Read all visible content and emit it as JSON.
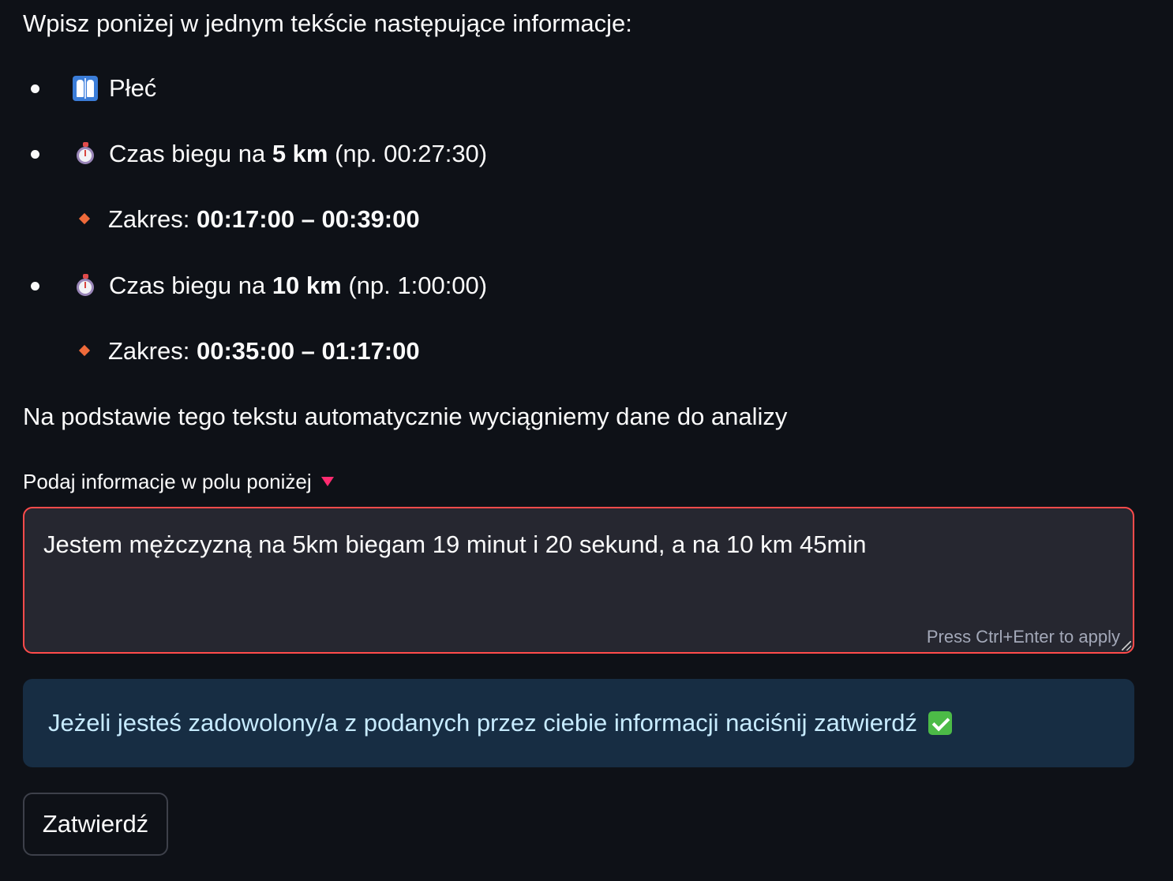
{
  "instructions": {
    "intro": "Wpisz poniżej w jednym tekście następujące informacje:",
    "items": [
      {
        "icon": "restroom-icon",
        "text": "Płeć"
      },
      {
        "icon": "stopwatch-icon",
        "prefix": "Czas biegu na ",
        "bold": "5 km",
        "suffix": " (np. 00:27:30)",
        "sub": {
          "icon": "orange-diamond-icon",
          "prefix": "Zakres: ",
          "bold": "00:17:00 – 00:39:00"
        }
      },
      {
        "icon": "stopwatch-icon",
        "prefix": "Czas biegu na ",
        "bold": "10 km",
        "suffix": " (np. 1:00:00)",
        "sub": {
          "icon": "orange-diamond-icon",
          "prefix": "Zakres: ",
          "bold": "00:35:00 – 01:17:00"
        }
      }
    ],
    "note": "Na podstawie tego tekstu automatycznie wyciągniemy dane do analizy"
  },
  "input": {
    "label": "Podaj informacje w polu poniżej",
    "value": "Jestem mężczyzną na 5km biegam 19 minut i 20 sekund, a na 10 km 45min",
    "hint": "Press Ctrl+Enter to apply"
  },
  "info": {
    "text": "Jeżeli jesteś zadowolony/a z podanych przez ciebie informacji naciśnij zatwierdź",
    "icon": "check-mark-button-icon"
  },
  "submit_button": {
    "label": "Zatwierdź"
  },
  "colors": {
    "background": "#0e1117",
    "text": "#fafafa",
    "input_border_error": "#ff4b4b",
    "input_background": "#262730",
    "info_background": "#172d43",
    "info_text": "#c7ebff",
    "diamond": "#ef6a3a",
    "caret": "#ff2b70"
  }
}
